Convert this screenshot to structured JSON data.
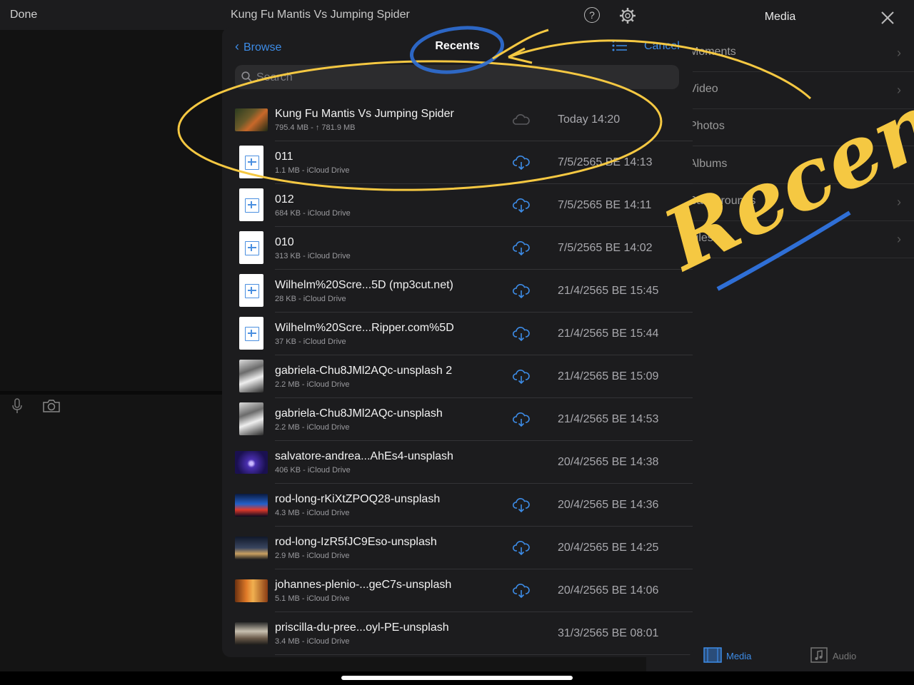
{
  "toolbar": {
    "done": "Done",
    "title": "Kung Fu Mantis Vs Jumping Spider",
    "help": "?"
  },
  "media": {
    "title": "Media",
    "rows": [
      {
        "label": "Moments"
      },
      {
        "label": "Video"
      },
      {
        "label": "Photos"
      },
      {
        "label": "Albums"
      },
      {
        "label": "Backgrounds"
      },
      {
        "label": "Files"
      }
    ],
    "tabs": {
      "media": "Media",
      "audio": "Audio"
    }
  },
  "picker": {
    "back": "Browse",
    "title": "Recents",
    "cancel": "Cancel",
    "search_placeholder": "Search",
    "files": [
      {
        "name": "Kung Fu Mantis Vs Jumping Spider",
        "meta": "795.4 MB - ↑ 781.9 MB",
        "date": "Today 14:20",
        "thumb": "video-mantis",
        "cloud": "uploading"
      },
      {
        "name": "011",
        "meta": "1.1 MB - iCloud Drive",
        "date": "7/5/2565 BE 14:13",
        "thumb": "audio-doc",
        "cloud": "download"
      },
      {
        "name": "012",
        "meta": "684 KB - iCloud Drive",
        "date": "7/5/2565 BE 14:11",
        "thumb": "audio-doc",
        "cloud": "download"
      },
      {
        "name": "010",
        "meta": "313 KB - iCloud Drive",
        "date": "7/5/2565 BE 14:02",
        "thumb": "audio-doc",
        "cloud": "download"
      },
      {
        "name": "Wilhelm%20Scre...5D (mp3cut.net)",
        "meta": "28 KB - iCloud Drive",
        "date": "21/4/2565 BE 15:45",
        "thumb": "audio-doc",
        "cloud": "download"
      },
      {
        "name": "Wilhelm%20Scre...Ripper.com%5D",
        "meta": "37 KB - iCloud Drive",
        "date": "21/4/2565 BE 15:44",
        "thumb": "audio-doc",
        "cloud": "download"
      },
      {
        "name": "gabriela-Chu8JMl2AQc-unsplash 2",
        "meta": "2.2 MB - iCloud Drive",
        "date": "21/4/2565 BE 15:09",
        "thumb": "photo-bw",
        "cloud": "download"
      },
      {
        "name": "gabriela-Chu8JMl2AQc-unsplash",
        "meta": "2.2 MB - iCloud Drive",
        "date": "21/4/2565 BE 14:53",
        "thumb": "photo-bw",
        "cloud": "download"
      },
      {
        "name": "salvatore-andrea...AhEs4-unsplash",
        "meta": "406 KB - iCloud Drive",
        "date": "20/4/2565 BE 14:38",
        "thumb": "photo-purple",
        "cloud": "none"
      },
      {
        "name": "rod-long-rKiXtZPOQ28-unsplash",
        "meta": "4.3 MB - iCloud Drive",
        "date": "20/4/2565 BE 14:36",
        "thumb": "photo-stage",
        "cloud": "download"
      },
      {
        "name": "rod-long-IzR5fJC9Eso-unsplash",
        "meta": "2.9 MB - iCloud Drive",
        "date": "20/4/2565 BE 14:25",
        "thumb": "photo-night",
        "cloud": "download"
      },
      {
        "name": "johannes-plenio-...geC7s-unsplash",
        "meta": "5.1 MB - iCloud Drive",
        "date": "20/4/2565 BE 14:06",
        "thumb": "photo-forest",
        "cloud": "download"
      },
      {
        "name": "priscilla-du-pree...oyl-PE-unsplash",
        "meta": "3.4 MB - iCloud Drive",
        "date": "31/3/2565 BE 08:01",
        "thumb": "photo-library",
        "cloud": "none"
      }
    ]
  },
  "annotation": {
    "handwriting": "Recents"
  },
  "colors": {
    "accent": "#3d8ce7",
    "annotation_yellow": "#f5c842",
    "annotation_blue": "#2f6fd6"
  }
}
